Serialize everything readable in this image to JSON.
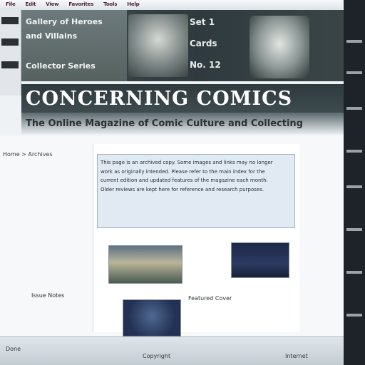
{
  "menubar": {
    "items": [
      "File",
      "Edit",
      "View",
      "Favorites",
      "Tools",
      "Help"
    ]
  },
  "banner": {
    "left_lines": [
      "Gallery of Heroes",
      "and Villains",
      "",
      "Collector Series"
    ],
    "stats": [
      "Set 1",
      "Cards",
      "No. 12"
    ]
  },
  "masthead": {
    "title": "CONCERNING COMICS"
  },
  "tagline": {
    "text": "The Online Magazine of Comic Culture and Collecting"
  },
  "page": {
    "breadcrumb": "Home > Archives",
    "notice_lines": [
      "This page is an archived copy. Some images and links may no longer",
      "work as originally intended. Please refer to the main index for the",
      "current edition and updated features of the magazine each month.",
      "Older reviews are kept here for reference and research purposes."
    ],
    "captions": {
      "left": "Issue Notes",
      "right": "Featured Cover"
    }
  },
  "statusbar": {
    "left": "Done",
    "center": "Copyright",
    "right": "Internet"
  }
}
